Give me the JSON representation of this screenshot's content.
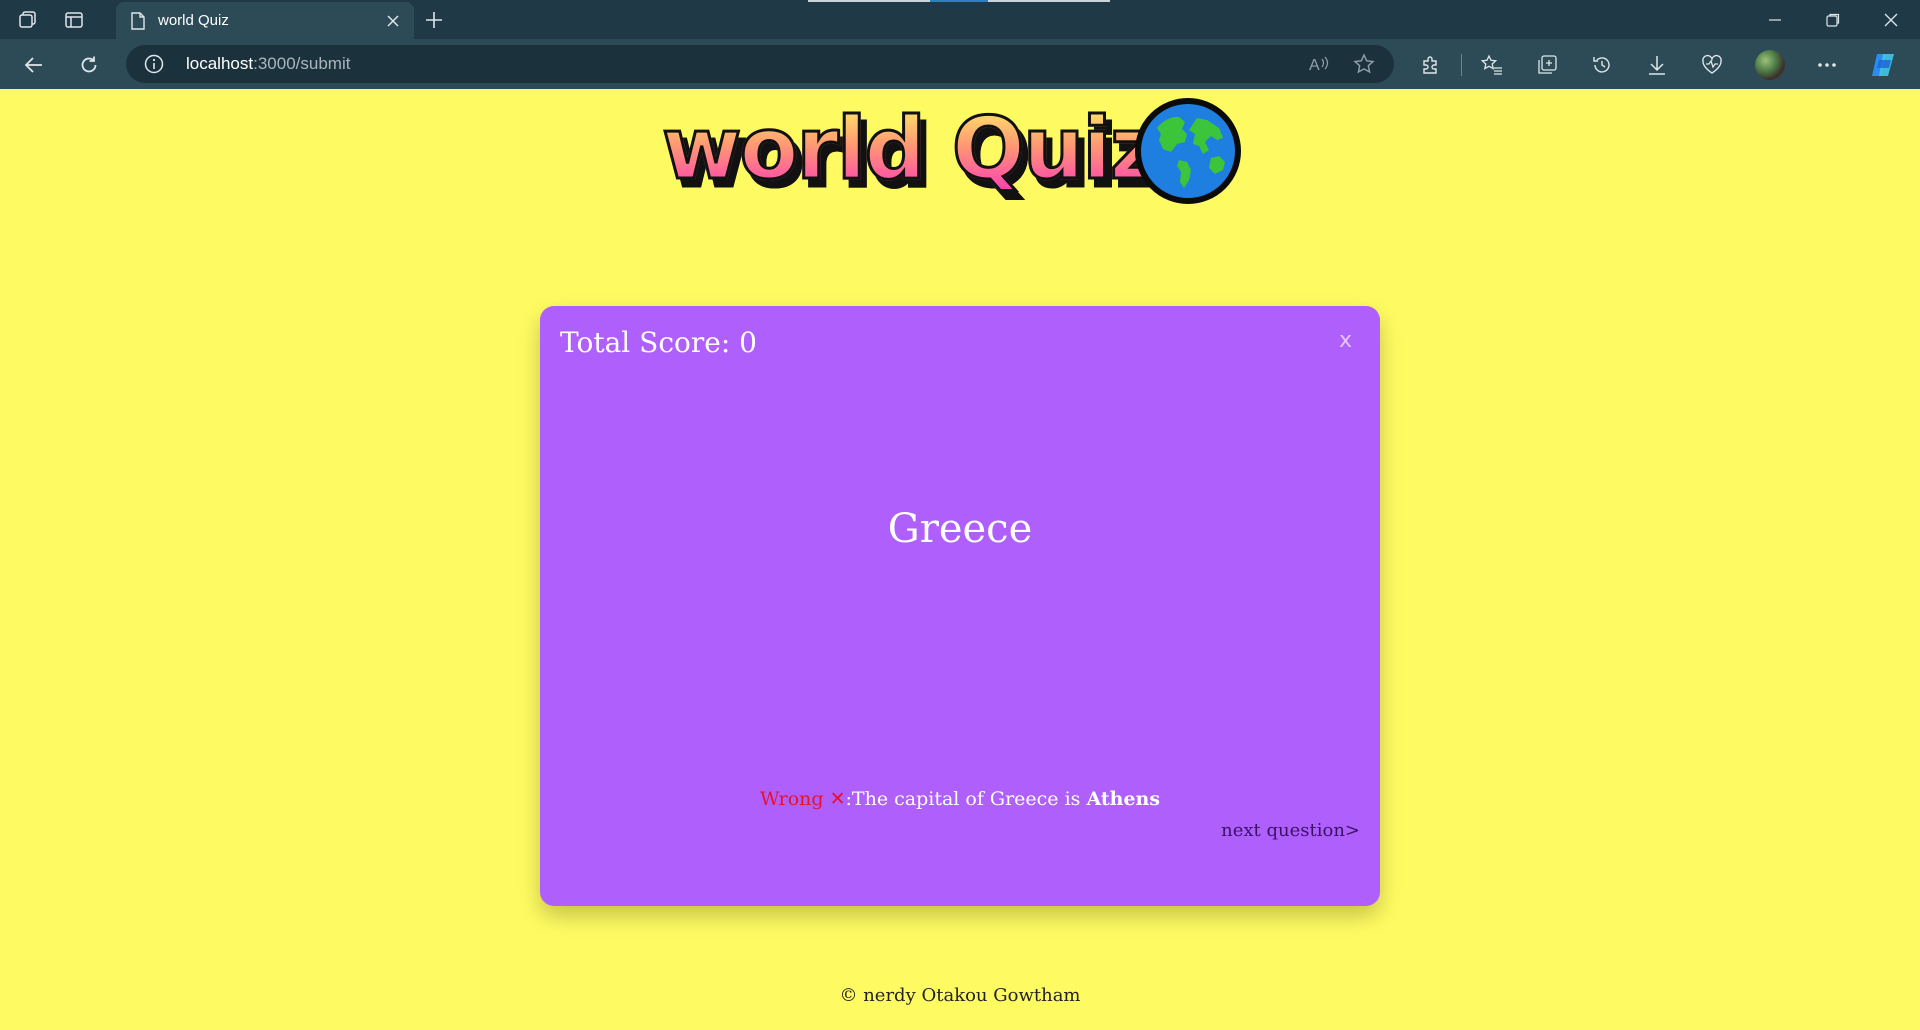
{
  "browser": {
    "tab": {
      "title": "world Quiz"
    },
    "address": {
      "host": "localhost",
      "rest": ":3000/submit"
    }
  },
  "page": {
    "logo_text": "world Quiz",
    "score_label": "Total Score: ",
    "score_value": "0",
    "close_label": "x",
    "country": "Greece",
    "feedback": {
      "wrong_label": "Wrong",
      "wrong_icon": "✕",
      "message": ":The capital of Greece is ",
      "answer": "Athens"
    },
    "next_label": "next question>",
    "footer": "© nerdy Otakou Gowtham"
  },
  "colors": {
    "page_bg": "#FEFB62",
    "card_bg": "#AE5FFC",
    "wrong": "#E8112D"
  }
}
